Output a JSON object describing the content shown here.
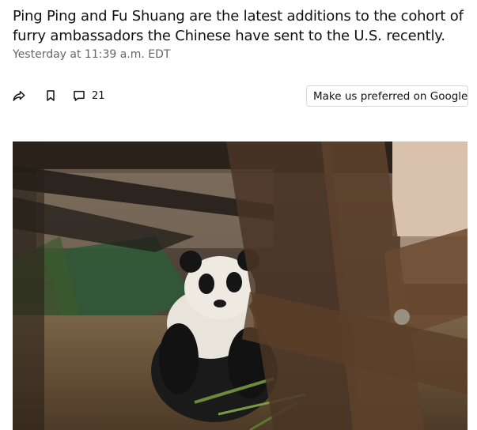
{
  "article": {
    "subheadline": "Ping Ping and Fu Shuang are the latest additions to the cohort of furry ambassadors the Chinese have sent to the U.S. recently.",
    "timestamp": "Yesterday at 11:39 a.m. EDT"
  },
  "actions": {
    "share_icon": "share-icon",
    "bookmark_icon": "bookmark-icon",
    "comment_icon": "comment-icon",
    "comment_count": "21"
  },
  "google_preference": {
    "label": "Make us preferred on Google",
    "icon": "google-g-icon"
  },
  "photo": {
    "subject": "panda"
  },
  "colors": {
    "text": "#111111",
    "meta": "#666666",
    "button_border": "#d8d8d8"
  }
}
